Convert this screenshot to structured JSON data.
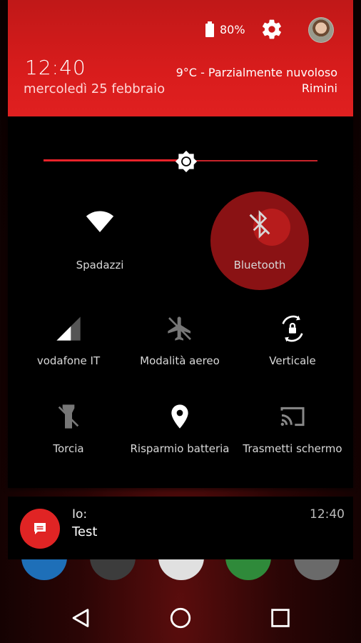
{
  "status": {
    "battery_percent": "80%",
    "battery_level": 0.8
  },
  "header": {
    "time": "12:40",
    "date": "mercoledì 25 febbraio",
    "weather": "9°C - Parzialmente nuvoloso",
    "location": "Rimini"
  },
  "brightness": {
    "level_fraction": 0.52
  },
  "tiles": [
    {
      "label": "Spadazzi",
      "icon": "wifi-icon"
    },
    {
      "label": "Bluetooth",
      "icon": "bluetooth-disabled-icon"
    },
    {
      "label": "vodafone IT",
      "icon": "cellular-signal-icon"
    },
    {
      "label": "Modalità aereo",
      "icon": "airplane-mode-icon"
    },
    {
      "label": "Verticale",
      "icon": "auto-rotate-locked-icon"
    },
    {
      "label": "Torcia",
      "icon": "flashlight-off-icon"
    },
    {
      "label": "Risparmio batteria",
      "icon": "location-icon"
    },
    {
      "label": "Trasmetti schermo",
      "icon": "cast-screen-icon"
    }
  ],
  "notification": {
    "sender": "Io:",
    "message": "Test",
    "time": "12:40",
    "icon": "message-icon"
  },
  "nav": {
    "back": "back-icon",
    "home": "home-icon",
    "recents": "recents-icon"
  },
  "colors": {
    "accent": "#e02020",
    "header_bg": "#d81c1c",
    "panel_bg": "#000000",
    "bluetooth_ripple": "#8a1214"
  }
}
